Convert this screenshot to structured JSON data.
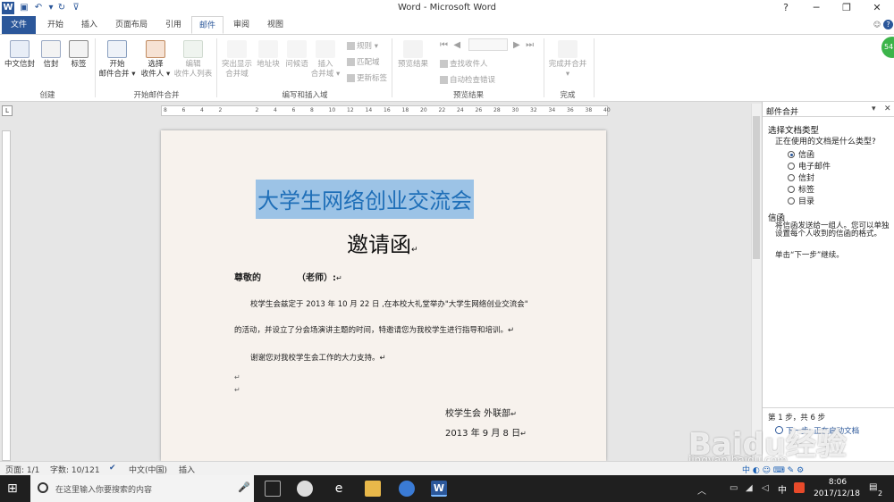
{
  "window": {
    "title": "Word  -  Microsoft Word",
    "help": "?",
    "avatar": "54"
  },
  "tabs": [
    "文件",
    "开始",
    "插入",
    "页面布局",
    "引用",
    "邮件",
    "审阅",
    "视图"
  ],
  "ribbon": {
    "create": {
      "label": "创建",
      "buttons": [
        "中文信封",
        "信封",
        "标签"
      ]
    },
    "start_merge": {
      "label": "开始邮件合并",
      "buttons": [
        {
          "line1": "开始",
          "line2": "邮件合并 ▾"
        },
        {
          "line1": "选择",
          "line2": "收件人 ▾"
        },
        {
          "line1": "编辑",
          "line2": "收件人列表"
        }
      ]
    },
    "write_insert": {
      "label": "编写和插入域",
      "buttons": [
        {
          "line1": "突出显示",
          "line2": "合并域"
        },
        {
          "line1": "地址块",
          "line2": ""
        },
        {
          "line1": "问候语",
          "line2": ""
        },
        {
          "line1": "插入",
          "line2": "合并域 ▾"
        }
      ],
      "small": [
        "规则 ▾",
        "匹配域",
        "更新标签"
      ]
    },
    "preview": {
      "label": "预览结果",
      "button": "预览结果",
      "small": [
        "查找收件人",
        "自动检查错误"
      ]
    },
    "finish": {
      "label": "完成",
      "button": "完成并合并",
      "arrow": "▾"
    }
  },
  "document": {
    "title": "大学生网络创业交流会",
    "subtitle": "邀请函",
    "greeting": "尊敬的",
    "teacher": "（老师）:",
    "para1": "校学生会兹定于 2013 年 10 月 22 日 ,在本校大礼堂举办\"大学生网络创业交流会\"",
    "para2": "的活动，并设立了分会场演讲主题的时间，特邀请您为我校学生进行指导和培训。",
    "para3": "谢谢您对我校学生会工作的大力支持。",
    "signature": "校学生会  外联部",
    "date": "2013 年 9 月 8 日",
    "mark": "↵"
  },
  "ruler": {
    "ticks": [
      "8",
      "6",
      "4",
      "2",
      "",
      "2",
      "4",
      "6",
      "8",
      "10",
      "12",
      "14",
      "16",
      "18",
      "20",
      "22",
      "24",
      "26",
      "28",
      "30",
      "32",
      "34",
      "36",
      "38",
      "40"
    ]
  },
  "pane": {
    "title": "邮件合并",
    "menu": "▾",
    "close": "✕",
    "section": "选择文档类型",
    "question": "正在使用的文档是什么类型?",
    "options": [
      "信函",
      "电子邮件",
      "信封",
      "标签",
      "目录"
    ],
    "selected": 0,
    "heading2": "信函",
    "desc": "将信函发送给一组人。您可以单独设置每个人收到的信函的格式。",
    "hint": "单击“下一步”继续。",
    "step": "第 1 步，共 6 步",
    "next": "下一步: 正在启动文档"
  },
  "status": {
    "page": "页面: 1/1",
    "words": "字数: 10/121",
    "lang": "中文(中国)",
    "mode": "插入"
  },
  "taskbar": {
    "search_placeholder": "在这里输入你要搜索的内容",
    "time": "8:06",
    "date": "2017/12/18",
    "ime": "中",
    "notif": "2"
  },
  "watermark": {
    "brand": "Baidu经验",
    "url": "jingyan.baidu.com"
  },
  "colors": {
    "accent": "#2b579a",
    "title_highlight": "#9cc3e6"
  }
}
